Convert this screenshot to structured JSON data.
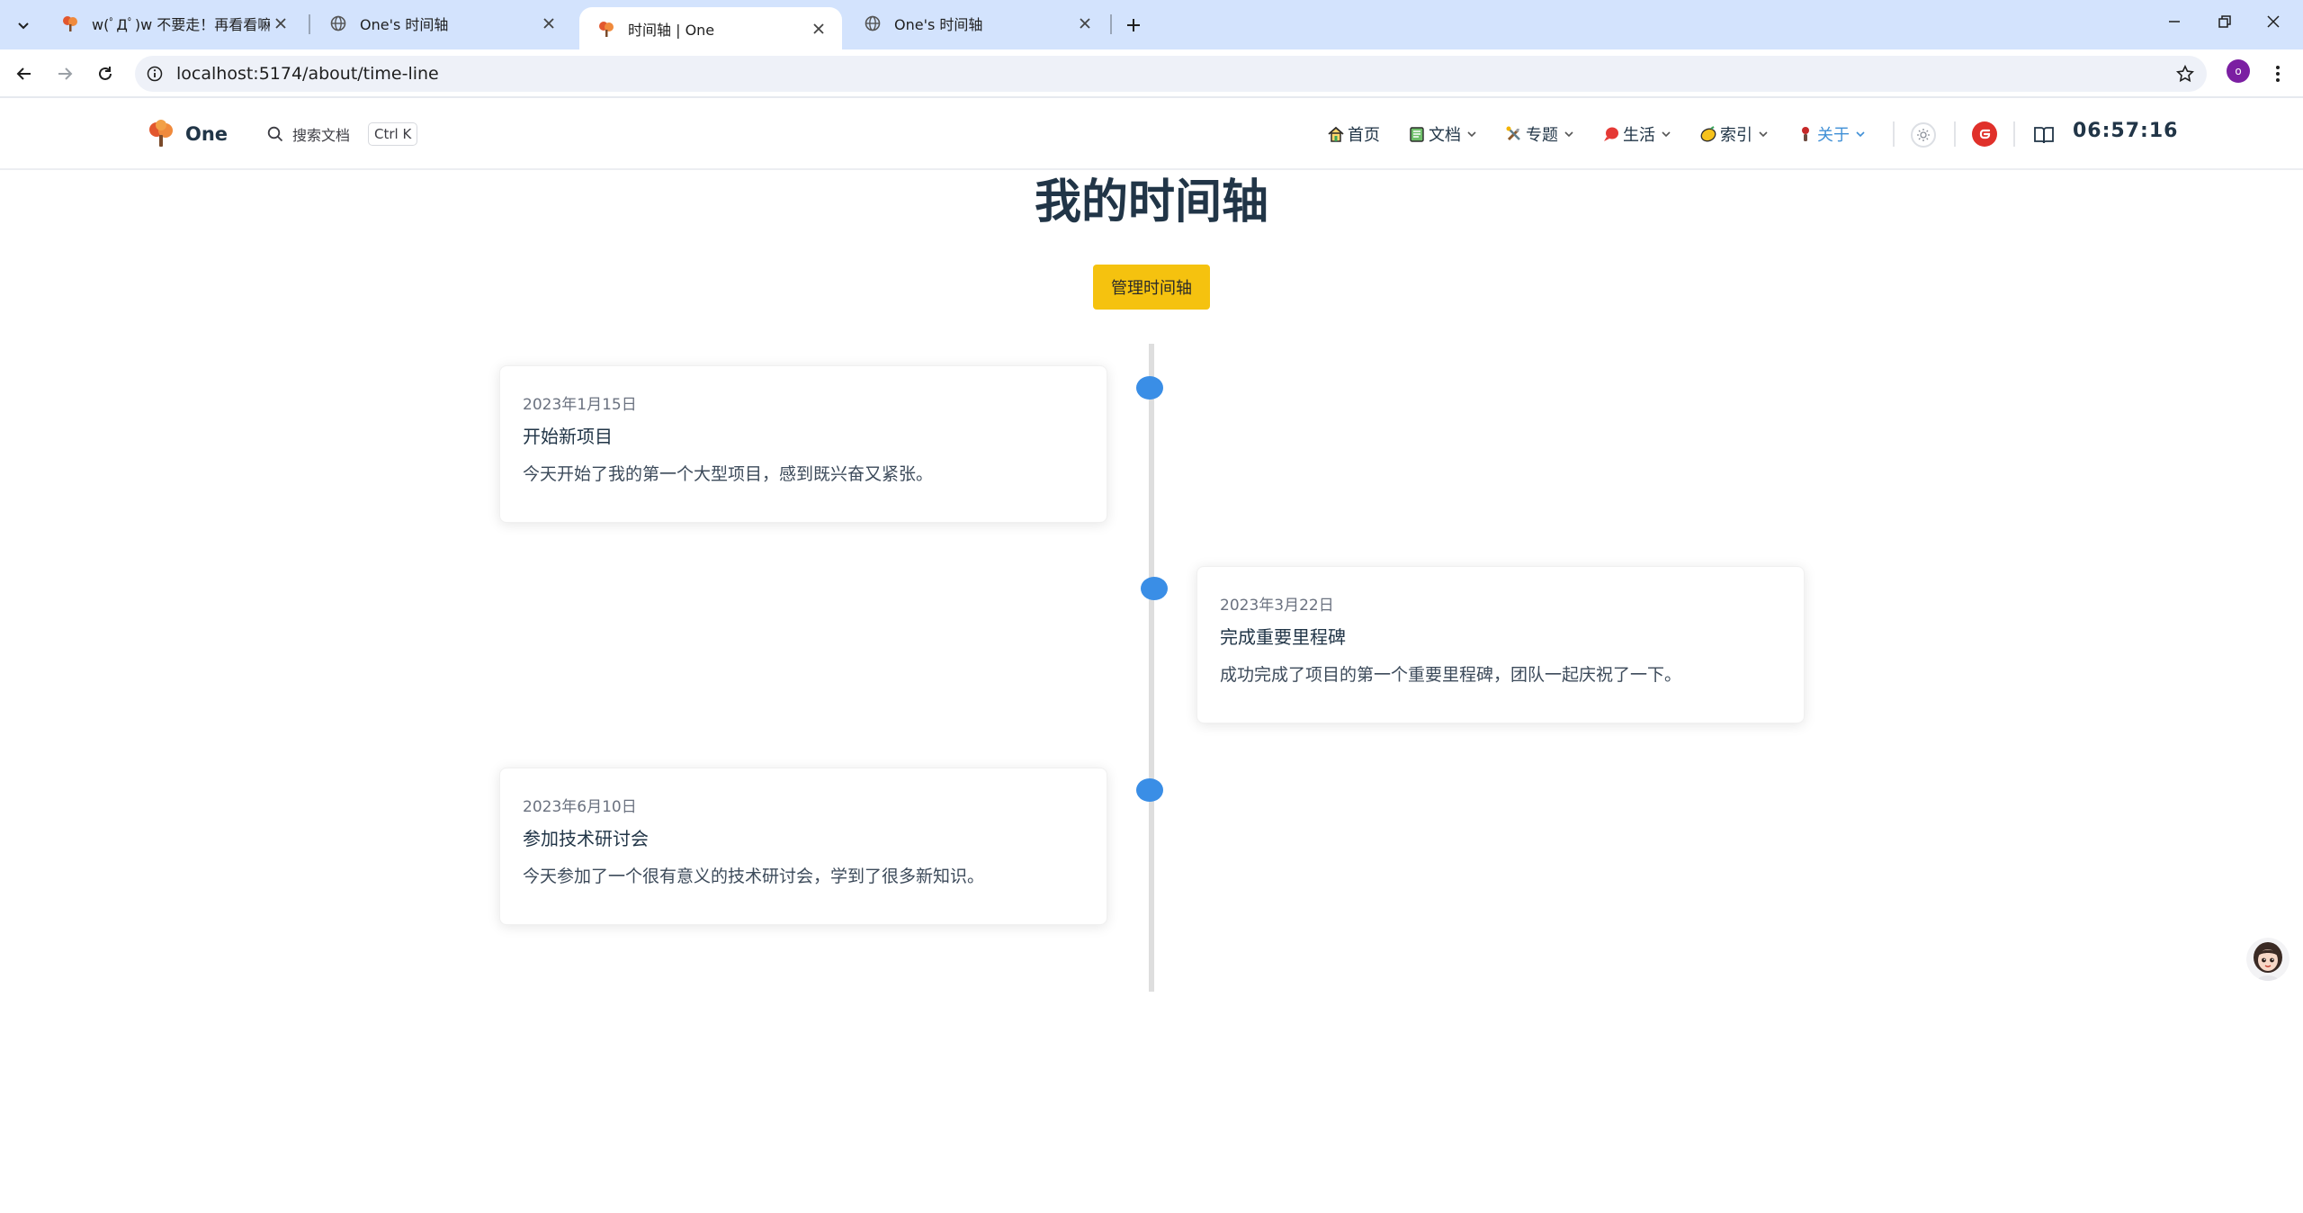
{
  "browser": {
    "tabs": [
      {
        "title": "w(ﾟДﾟ)w 不要走！再看看嘛！",
        "active": false
      },
      {
        "title": "One's 时间轴",
        "active": false
      },
      {
        "title": "时间轴 | One",
        "active": true
      },
      {
        "title": "One's 时间轴",
        "active": false
      }
    ],
    "url": "localhost:5174/about/time-line",
    "profile_initial": "o"
  },
  "navbar": {
    "brand": "One",
    "search_label": "搜索文档",
    "search_shortcut": "Ctrl K",
    "items": [
      {
        "label": "首页",
        "icon": "house-icon",
        "dropdown": false
      },
      {
        "label": "文档",
        "icon": "notebook-icon",
        "dropdown": true
      },
      {
        "label": "专题",
        "icon": "tools-icon",
        "dropdown": true
      },
      {
        "label": "生活",
        "icon": "red-bubble-icon",
        "dropdown": true
      },
      {
        "label": "索引",
        "icon": "lemon-icon",
        "dropdown": true
      },
      {
        "label": "关于",
        "icon": "figure-icon",
        "dropdown": true,
        "active": true
      }
    ],
    "clock": "06:57:16"
  },
  "page": {
    "title": "我的时间轴",
    "manage_button": "管理时间轴"
  },
  "timeline": [
    {
      "date": "2023年1月15日",
      "title": "开始新项目",
      "desc": "今天开始了我的第一个大型项目，感到既兴奋又紧张。",
      "side": "left"
    },
    {
      "date": "2023年3月22日",
      "title": "完成重要里程碑",
      "desc": "成功完成了项目的第一个重要里程碑，团队一起庆祝了一下。",
      "side": "right"
    },
    {
      "date": "2023年6月10日",
      "title": "参加技术研讨会",
      "desc": "今天参加了一个很有意义的技术研讨会，学到了很多新知识。",
      "side": "left"
    }
  ],
  "colors": {
    "accent": "#3a8ee6",
    "button": "#f5c20f",
    "chrome_tabstrip": "#d3e3fd",
    "active_nav": "#3f8fd6"
  }
}
